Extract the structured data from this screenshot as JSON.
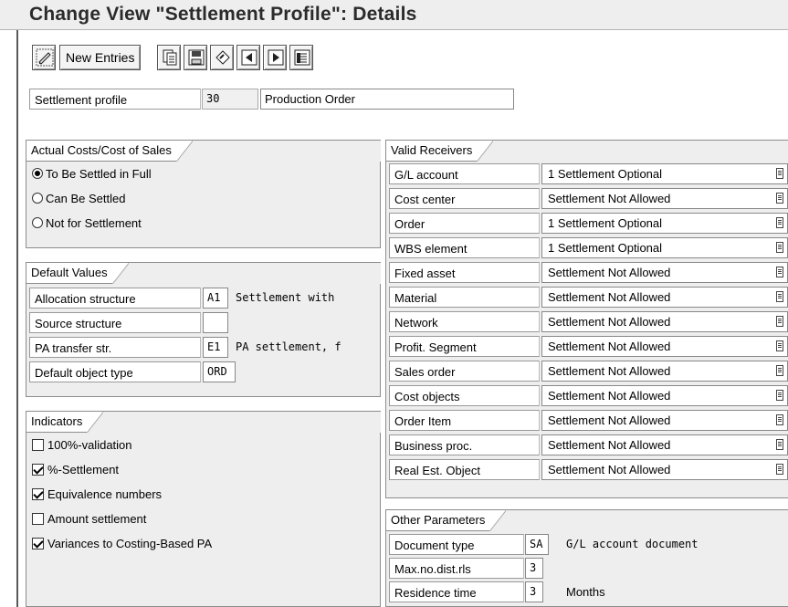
{
  "header": {
    "title": "Change View \"Settlement Profile\": Details"
  },
  "toolbar": {
    "new_entries": "New Entries"
  },
  "profile": {
    "label": "Settlement profile",
    "code": "30",
    "name": "Production Order"
  },
  "actual_costs": {
    "title": "Actual Costs/Cost of Sales",
    "options": [
      "To Be Settled in Full",
      "Can Be Settled",
      "Not for Settlement"
    ],
    "selected_index": 0
  },
  "defaults": {
    "title": "Default Values",
    "rows": [
      {
        "label": "Allocation structure",
        "value": "A1",
        "desc": "Settlement with"
      },
      {
        "label": "Source structure",
        "value": "",
        "desc": ""
      },
      {
        "label": "PA transfer str.",
        "value": "E1",
        "desc": "PA settlement, f"
      },
      {
        "label": "Default object type",
        "value": "ORD",
        "desc": ""
      }
    ]
  },
  "indicators": {
    "title": "Indicators",
    "items": [
      {
        "label": "100%-validation",
        "checked": false
      },
      {
        "label": "%-Settlement",
        "checked": true
      },
      {
        "label": "Equivalence numbers",
        "checked": true
      },
      {
        "label": "Amount settlement",
        "checked": false
      },
      {
        "label": "Variances to Costing-Based PA",
        "checked": true
      }
    ]
  },
  "receivers": {
    "title": "Valid Receivers",
    "rows": [
      {
        "label": "G/L account",
        "value": "1 Settlement Optional"
      },
      {
        "label": "Cost center",
        "value": "Settlement Not Allowed"
      },
      {
        "label": "Order",
        "value": "1 Settlement Optional"
      },
      {
        "label": "WBS element",
        "value": "1 Settlement Optional"
      },
      {
        "label": "Fixed asset",
        "value": "Settlement Not Allowed"
      },
      {
        "label": "Material",
        "value": "Settlement Not Allowed"
      },
      {
        "label": "Network",
        "value": "Settlement Not Allowed"
      },
      {
        "label": "Profit. Segment",
        "value": "Settlement Not Allowed"
      },
      {
        "label": "Sales order",
        "value": "Settlement Not Allowed"
      },
      {
        "label": "Cost objects",
        "value": "Settlement Not Allowed"
      },
      {
        "label": "Order Item",
        "value": "Settlement Not Allowed"
      },
      {
        "label": "Business proc.",
        "value": "Settlement Not Allowed"
      },
      {
        "label": "Real Est. Object",
        "value": "Settlement Not Allowed"
      }
    ]
  },
  "other": {
    "title": "Other Parameters",
    "rows": [
      {
        "label": "Document type",
        "value": "SA",
        "desc": "G/L account document"
      },
      {
        "label": "Max.no.dist.rls",
        "value": "3",
        "desc": ""
      },
      {
        "label": "Residence time",
        "value": "3",
        "desc": "Months"
      }
    ]
  },
  "icons": [
    "display-change-icon",
    "copy-icon",
    "save-icon",
    "undo-icon",
    "prev-entry-icon",
    "next-entry-icon",
    "select-block-icon",
    "dropdown-icon"
  ]
}
